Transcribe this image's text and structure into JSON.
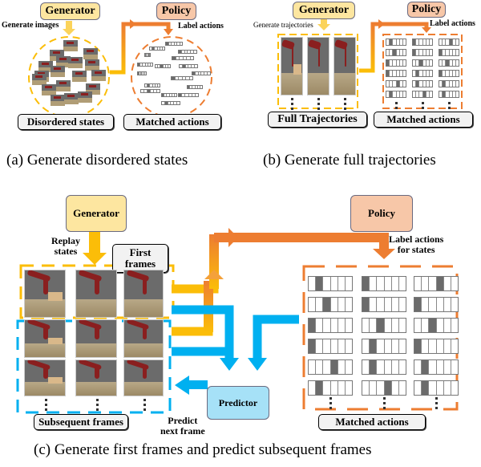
{
  "panel_a": {
    "generator": "Generator",
    "generate_note": "Generate images",
    "policy": "Policy",
    "label_note": "Label actions",
    "states_label": "Disordered states",
    "actions_label": "Matched actions",
    "caption": "(a)  Generate disordered states"
  },
  "panel_b": {
    "generator": "Generator",
    "generate_note": "Generate trajectories",
    "policy": "Policy",
    "label_note": "Label actions",
    "states_label": "Full Trajectories",
    "actions_label": "Matched actions",
    "caption": "(b)  Generate full trajectories"
  },
  "panel_c": {
    "generator": "Generator",
    "replay_note": "Replay\nstates",
    "first_frames": "First\nframes",
    "policy": "Policy",
    "label_note": "Label actions\nfor states",
    "predictor": "Predictor",
    "predict_note": "Predict\nnext frame",
    "subsequent_label": "Subsequent frames",
    "actions_label": "Matched actions",
    "caption": "(c)  Generate first frames and predict subsequent frames",
    "action_columns": [
      [
        1,
        2,
        0,
        0,
        3,
        1
      ],
      [
        0,
        0,
        2,
        1,
        1,
        3
      ],
      [
        3,
        0,
        2,
        0,
        1,
        1
      ]
    ]
  },
  "colors": {
    "generator_fill": "#fde6a0",
    "policy_fill": "#f7c7a8",
    "predictor_fill": "#a6e1f7",
    "yellow_arrow": "#fbbd08",
    "orange_arrow": "#ed7d31",
    "blue_arrow": "#00b0f0"
  }
}
